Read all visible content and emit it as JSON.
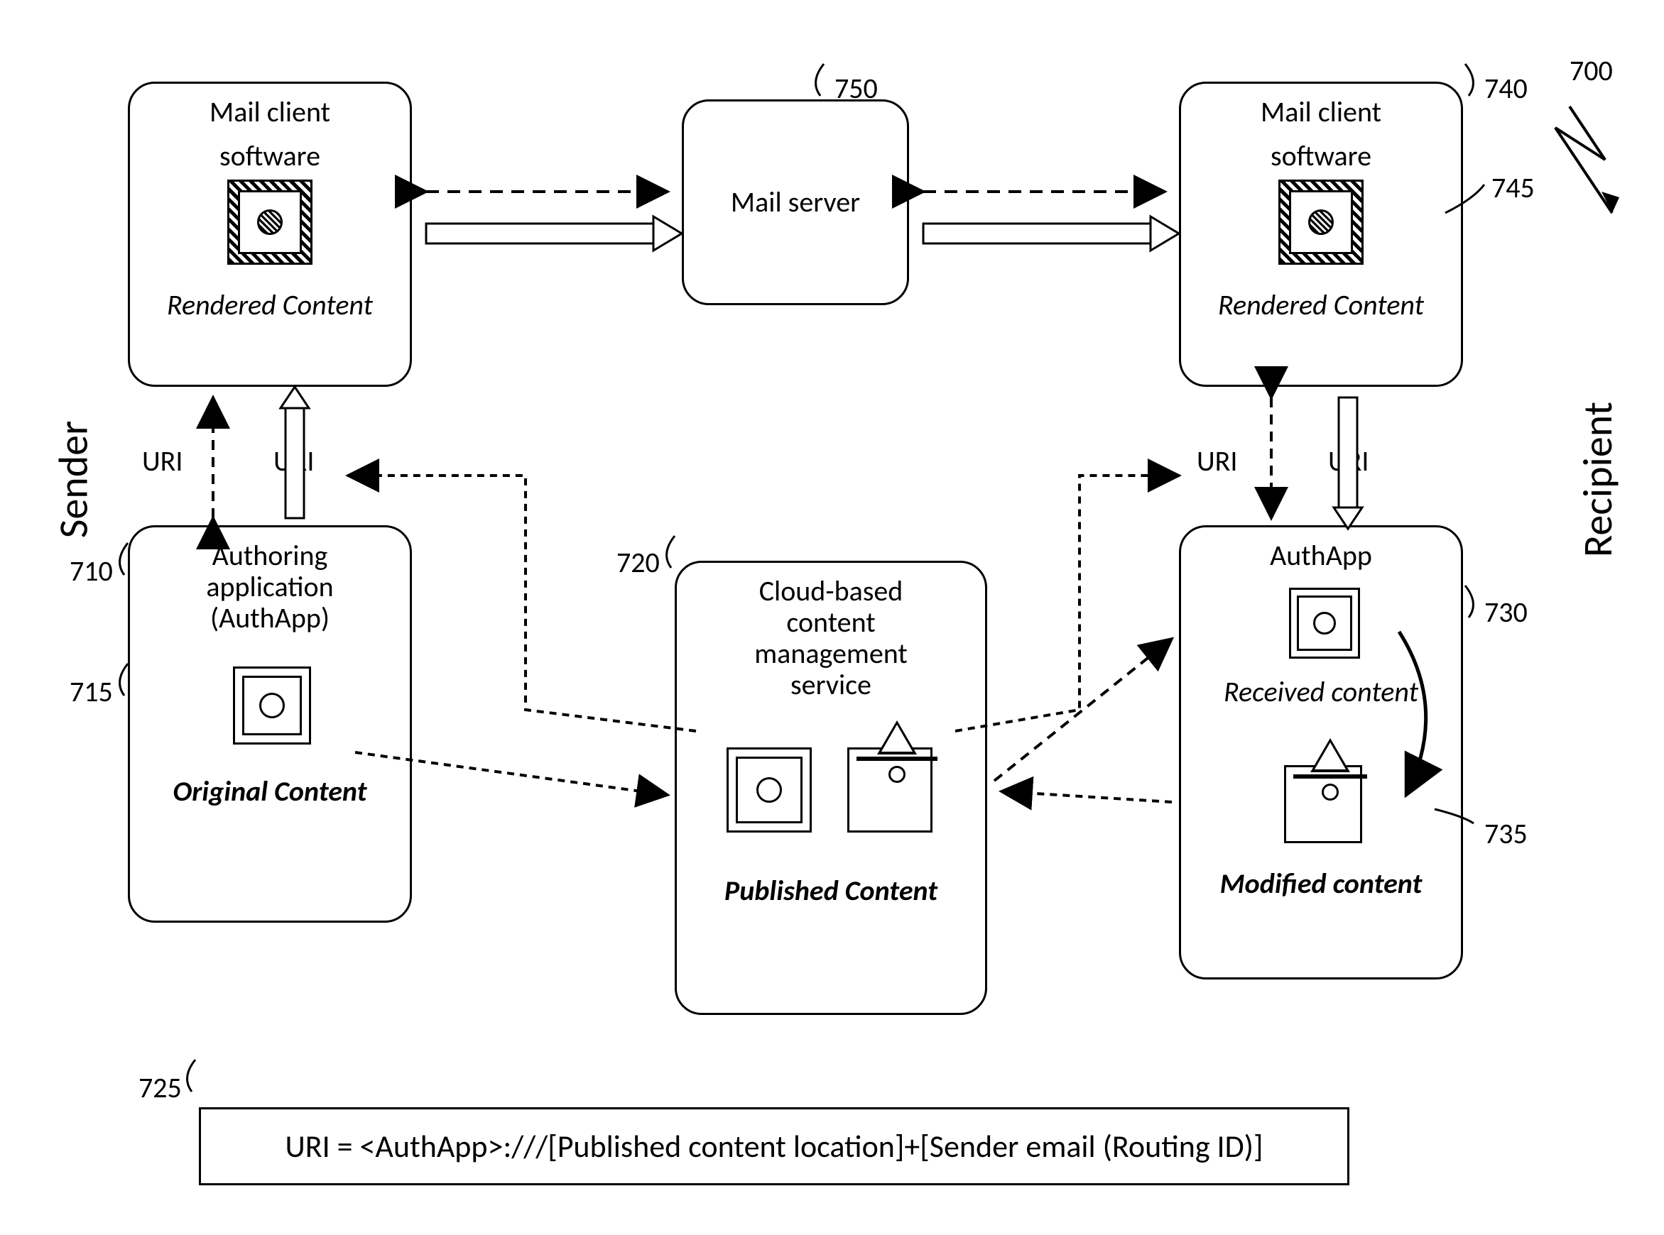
{
  "figure_number": "700",
  "sender_label": "Sender",
  "recipient_label": "Recipient",
  "uri_label": "URI",
  "refs": {
    "r710": "710",
    "r715": "715",
    "r720": "720",
    "r725": "725",
    "r730": "730",
    "r735": "735",
    "r740": "740",
    "r745": "745",
    "r750": "750"
  },
  "boxes": {
    "sender_mail_client": {
      "line1": "Mail client",
      "line2": "software",
      "content_label": "Rendered Content"
    },
    "recipient_mail_client": {
      "line1": "Mail client",
      "line2": "software",
      "content_label": "Rendered Content"
    },
    "mail_server": "Mail server",
    "authoring_app": {
      "line1": "Authoring",
      "line2": "application",
      "line3": "(AuthApp)",
      "content_label": "Original Content"
    },
    "cloud_service": {
      "line1": "Cloud-based",
      "line2": "content",
      "line3": "management",
      "line4": "service",
      "content_label": "Published Content"
    },
    "recipient_authapp": {
      "title": "AuthApp",
      "received_label": "Received content",
      "modified_label": "Modified content"
    }
  },
  "formula": "URI = <AuthApp>:///[Published content location]+[Sender email (Routing ID)]"
}
